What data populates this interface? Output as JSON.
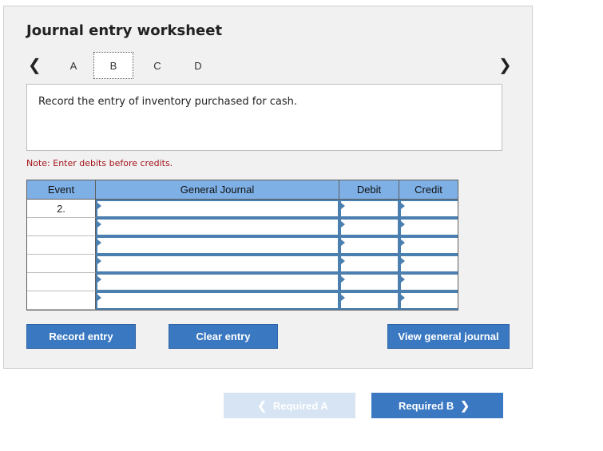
{
  "title": "Journal entry worksheet",
  "tabs": [
    {
      "label": "A"
    },
    {
      "label": "B",
      "active": true
    },
    {
      "label": "C"
    },
    {
      "label": "D"
    }
  ],
  "prompt": "Record the entry of inventory purchased for cash.",
  "note": "Note: Enter debits before credits.",
  "table": {
    "headers": {
      "event": "Event",
      "account": "General Journal",
      "debit": "Debit",
      "credit": "Credit"
    },
    "rows": [
      {
        "event": "2.",
        "account": "",
        "debit": "",
        "credit": ""
      },
      {
        "event": "",
        "account": "",
        "debit": "",
        "credit": ""
      },
      {
        "event": "",
        "account": "",
        "debit": "",
        "credit": ""
      },
      {
        "event": "",
        "account": "",
        "debit": "",
        "credit": ""
      },
      {
        "event": "",
        "account": "",
        "debit": "",
        "credit": ""
      },
      {
        "event": "",
        "account": "",
        "debit": "",
        "credit": ""
      }
    ]
  },
  "buttons": {
    "record": "Record entry",
    "clear": "Clear entry",
    "view": "View general journal"
  },
  "footer": {
    "prev_label": "Required A",
    "next_label": "Required B"
  },
  "icons": {
    "prev": "chevron-left-icon",
    "next": "chevron-right-icon"
  },
  "colors": {
    "accent": "#3a78c2",
    "header_bg": "#7eb0e6",
    "note": "#a3141b"
  }
}
